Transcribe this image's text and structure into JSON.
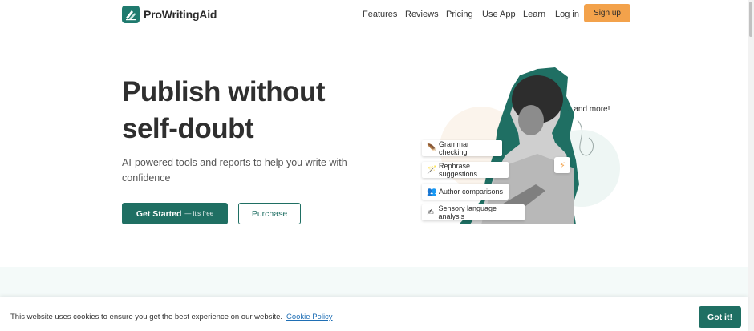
{
  "brand": {
    "name": "ProWritingAid",
    "accent": "#1f6f63",
    "signup_color": "#f3a24b"
  },
  "nav": {
    "features": "Features",
    "reviews": "Reviews",
    "pricing": "Pricing",
    "use_app": "Use App",
    "learn": "Learn",
    "login": "Log in",
    "signup": "Sign up"
  },
  "hero": {
    "title": "Publish without self-doubt",
    "subtitle": "AI-powered tools and reports to help you write with confidence",
    "cta_primary": "Get Started",
    "cta_primary_note": "— it's free",
    "cta_secondary": "Purchase"
  },
  "illustration": {
    "features": [
      {
        "icon": "quill-icon",
        "glyph": "🪶",
        "label": "Grammar checking"
      },
      {
        "icon": "wand-icon",
        "glyph": "🪄",
        "label": "Rephrase suggestions"
      },
      {
        "icon": "people-icon",
        "glyph": "👥",
        "label": "Author comparisons"
      },
      {
        "icon": "sparkles-icon",
        "glyph": "✍",
        "label": "Sensory language analysis"
      }
    ],
    "and_more": "...and more!",
    "bolt_icon": "bolt-icon"
  },
  "cookie": {
    "text": "This website uses cookies to ensure you get the best experience on our website.",
    "link": "Cookie Policy",
    "button": "Got it!"
  }
}
